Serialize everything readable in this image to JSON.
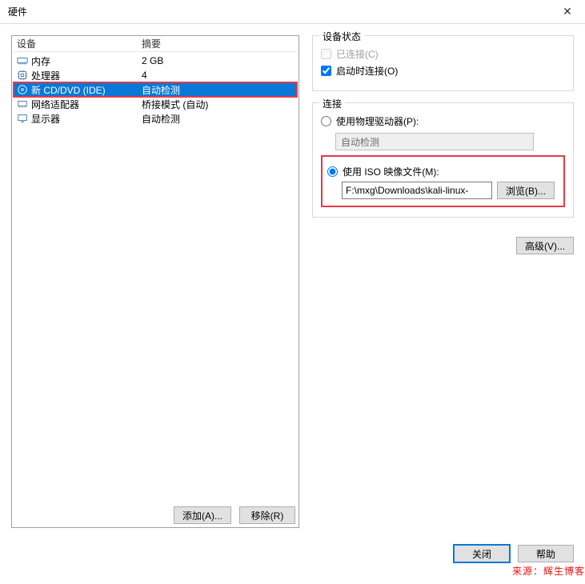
{
  "window": {
    "title": "硬件"
  },
  "list": {
    "col_device": "设备",
    "col_summary": "摘要",
    "rows": [
      {
        "icon": "memory-icon",
        "name": "内存",
        "summary": "2 GB",
        "selected": false
      },
      {
        "icon": "cpu-icon",
        "name": "处理器",
        "summary": "4",
        "selected": false
      },
      {
        "icon": "cd-icon",
        "name": "新 CD/DVD (IDE)",
        "summary": "自动检测",
        "selected": true
      },
      {
        "icon": "nic-icon",
        "name": "网络适配器",
        "summary": "桥接模式 (自动)",
        "selected": false
      },
      {
        "icon": "display-icon",
        "name": "显示器",
        "summary": "自动检测",
        "selected": false
      }
    ],
    "add_label": "添加(A)...",
    "remove_label": "移除(R)"
  },
  "status": {
    "legend": "设备状态",
    "connected_label": "已连接(C)",
    "connected_checked": false,
    "connected_enabled": false,
    "connect_at_poweron_label": "启动时连接(O)",
    "connect_at_poweron_checked": true
  },
  "connection": {
    "legend": "连接",
    "physical_label": "使用物理驱动器(P):",
    "physical_selected": false,
    "physical_dropdown_value": "自动检测",
    "iso_label": "使用 ISO 映像文件(M):",
    "iso_selected": true,
    "iso_path": "F:\\mxg\\Downloads\\kali-linux-",
    "browse_label": "浏览(B)...",
    "advanced_label": "高级(V)..."
  },
  "footer": {
    "close_label": "关闭",
    "help_label": "帮助"
  },
  "watermark": "来源：辉生博客"
}
